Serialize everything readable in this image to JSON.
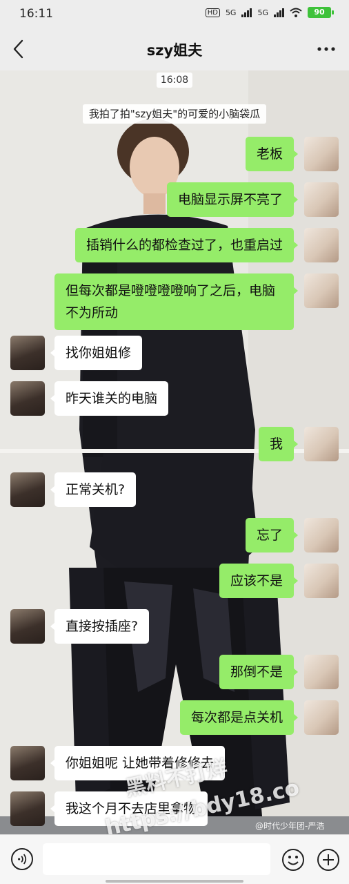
{
  "status_bar": {
    "time": "16:11",
    "hd_label": "HD",
    "sim1_label": "5G",
    "sim2_label": "5G",
    "battery": "90"
  },
  "nav": {
    "title": "szy姐夫"
  },
  "chat": {
    "timestamp": "16:08",
    "system_message": "我拍了拍\"szy姐夫\"的可爱的小脑袋瓜",
    "messages": [
      {
        "sender": "me",
        "text": "老板"
      },
      {
        "sender": "me",
        "text": "电脑显示屏不亮了"
      },
      {
        "sender": "me",
        "text": "插销什么的都检查过了，也重启过"
      },
      {
        "sender": "me",
        "text": "但每次都是噔噔噔噔响了之后，电脑不为所动"
      },
      {
        "sender": "other",
        "text": "找你姐姐修"
      },
      {
        "sender": "other",
        "text": "昨天谁关的电脑"
      },
      {
        "sender": "me",
        "text": "我"
      },
      {
        "sender": "other",
        "text": "正常关机?"
      },
      {
        "sender": "me",
        "text": "忘了"
      },
      {
        "sender": "me",
        "text": "应该不是"
      },
      {
        "sender": "other",
        "text": "直接按插座?"
      },
      {
        "sender": "me",
        "text": "那倒不是"
      },
      {
        "sender": "me",
        "text": "每次都是点关机"
      },
      {
        "sender": "other",
        "text": "你姐姐呢 让她带着修修去"
      },
      {
        "sender": "other",
        "text": "我这个月不去店里拿物"
      }
    ]
  },
  "watermark": {
    "line1": "黑料不打烊",
    "line2": "https://bdy18.co",
    "credit": "@时代少年团-严浩"
  },
  "colors": {
    "bubble_me": "#95ec69",
    "bubble_other": "#ffffff",
    "background": "#ededed"
  },
  "icons": [
    "back-icon",
    "more-icon",
    "voice-icon",
    "emoji-icon",
    "plus-icon"
  ]
}
